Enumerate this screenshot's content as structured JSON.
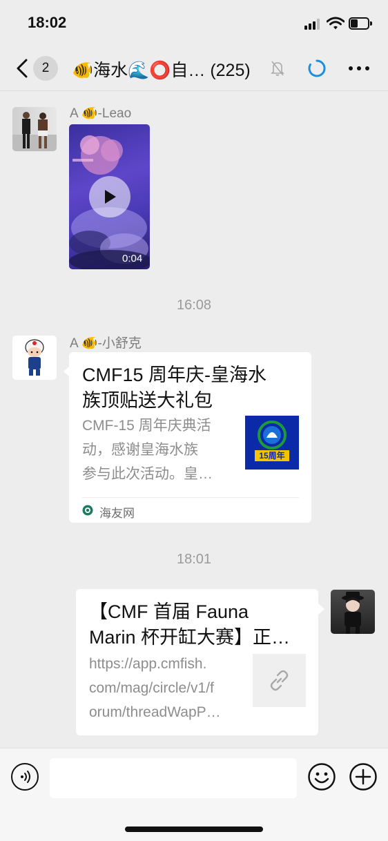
{
  "status_bar": {
    "time": "18:02"
  },
  "header": {
    "unread_count": "2",
    "title": "🐠海水🌊⭕自… (225)"
  },
  "messages": [
    {
      "sender": "A 🐠-Leao",
      "type": "video",
      "duration": "0:04"
    },
    {
      "timestamp": "16:08"
    },
    {
      "sender": "A 🐠-小舒克",
      "type": "link-card",
      "title_lines": [
        "CMF15 周年庆-皇海水",
        "族顶贴送大礼包"
      ],
      "desc_lines": [
        "CMF-15 周年庆典活",
        "动，感谢皇海水族",
        "参与此次活动。皇…"
      ],
      "thumb_text": "15周年",
      "source": "海友网"
    },
    {
      "timestamp": "18:01"
    },
    {
      "sender": "me",
      "type": "link-card",
      "title_lines": [
        "【CMF 首届 Fauna",
        "Marin 杯开缸大赛】正…"
      ],
      "desc_lines": [
        "https://app.cmfish.",
        "com/mag/circle/v1/f",
        "orum/threadWapP…"
      ]
    }
  ],
  "colors": {
    "background": "#ededed",
    "card": "#ffffff",
    "accent_blue": "#1a8fe0",
    "muted_text": "#8d8d8d"
  }
}
